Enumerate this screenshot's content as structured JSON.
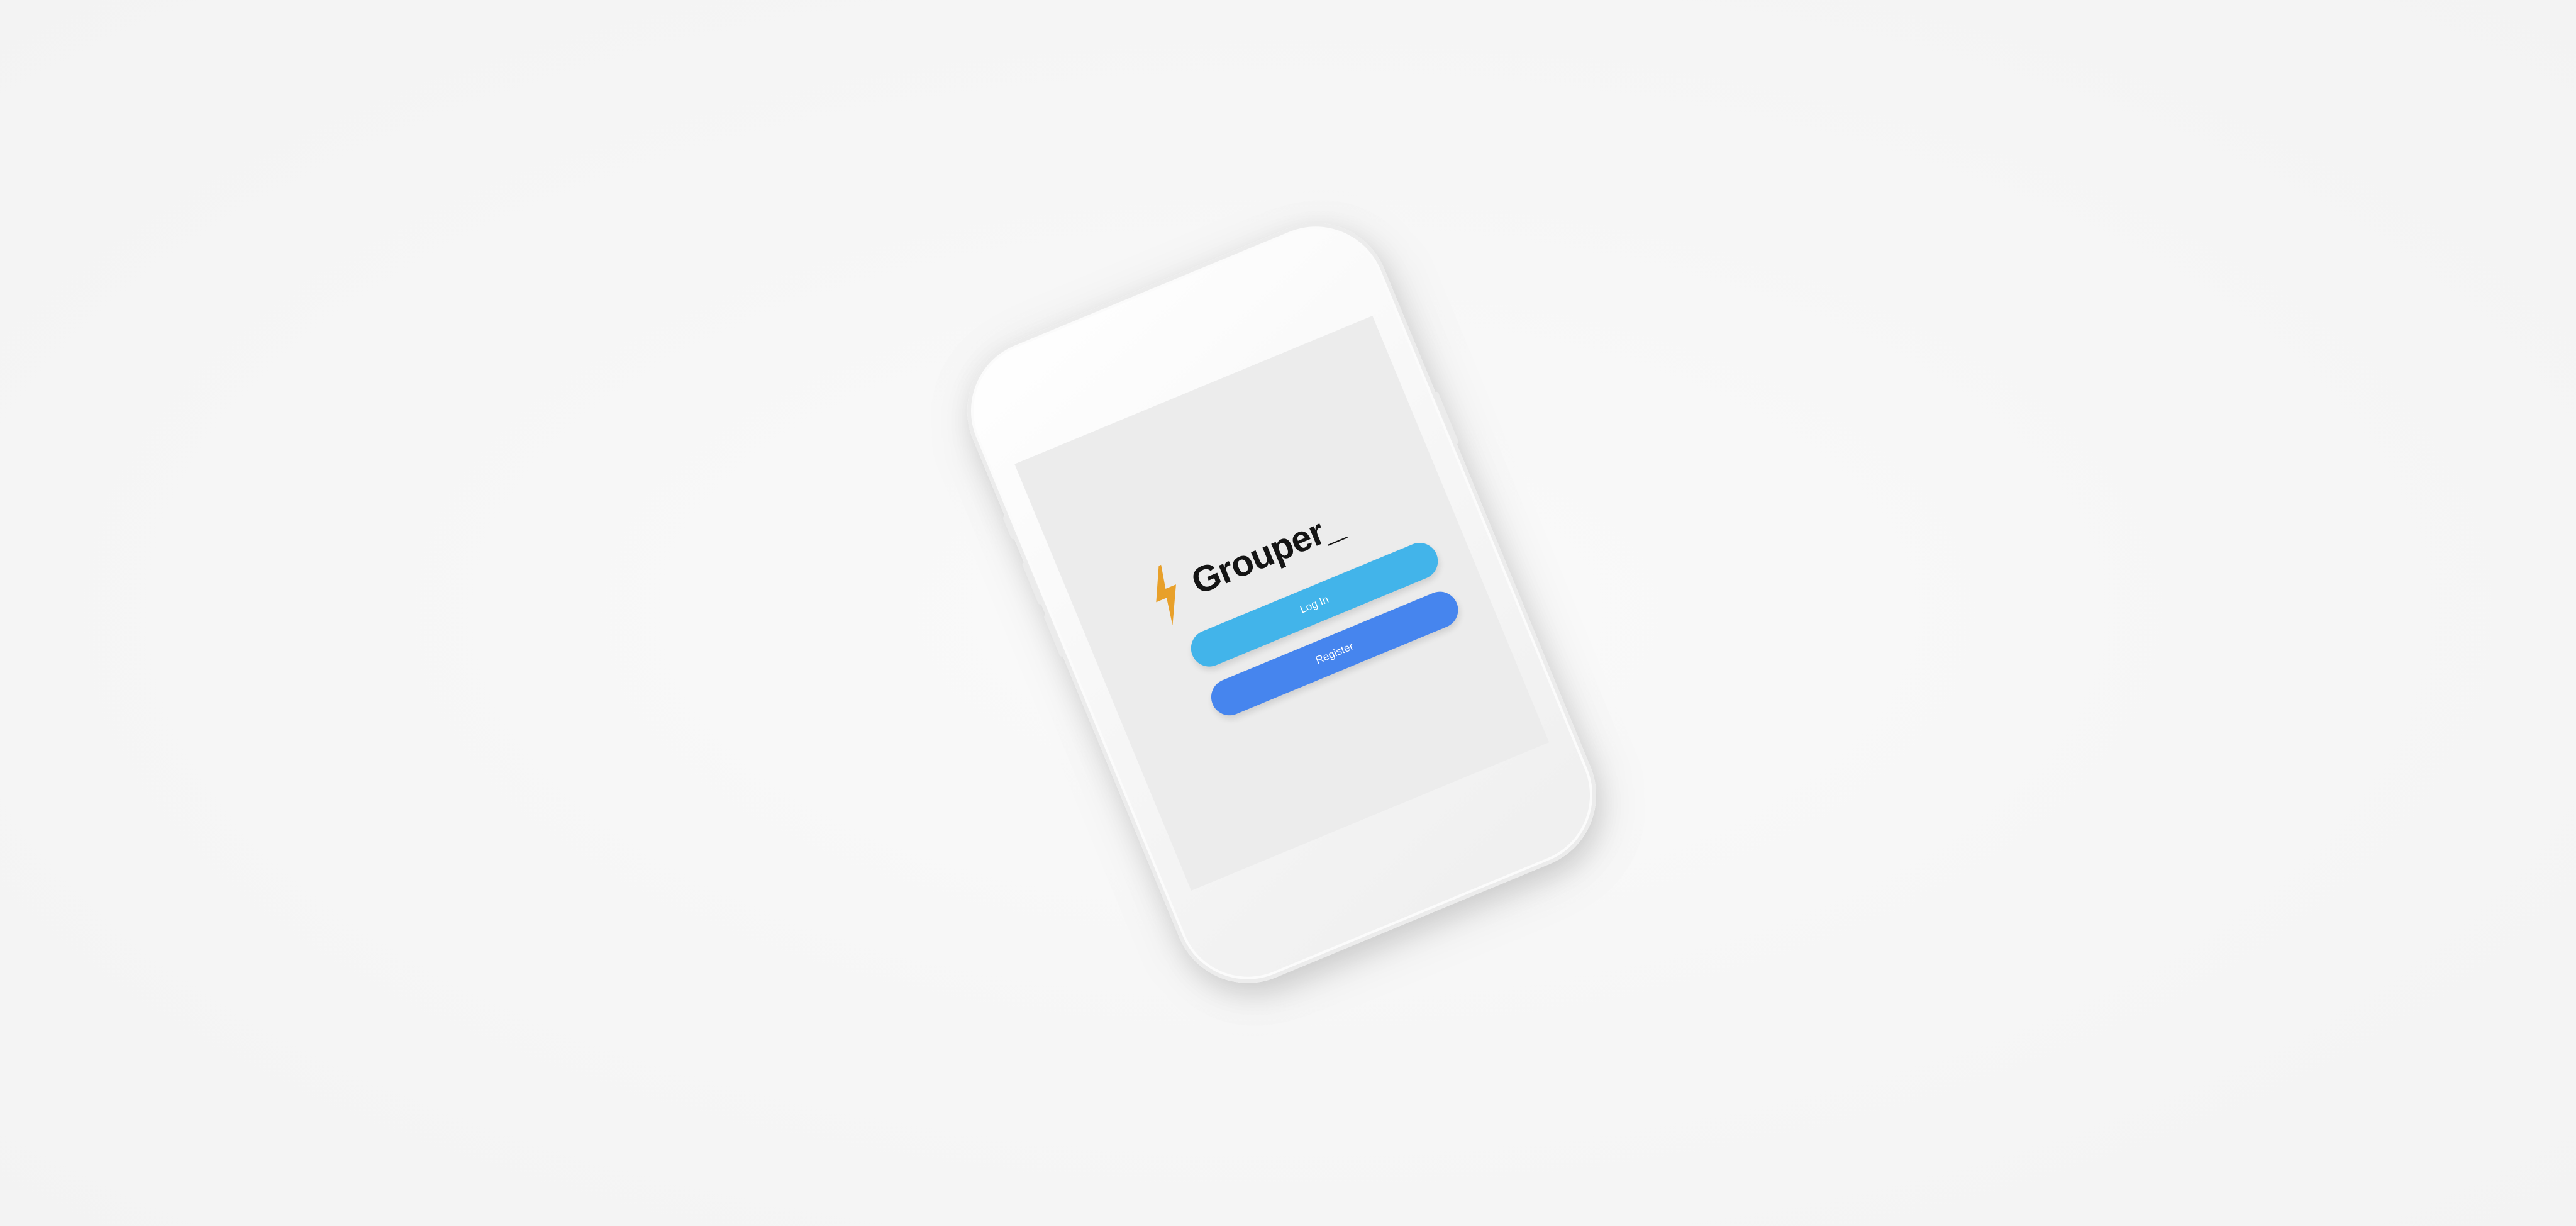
{
  "app": {
    "brand_name": "Grouper_",
    "logo_icon": "lightning-bolt-icon"
  },
  "actions": {
    "login_label": "Log In",
    "register_label": "Register"
  },
  "colors": {
    "background": "#f7f7f7",
    "screen": "#ececec",
    "bolt": "#e8a02a",
    "login_button": "#42b4ea",
    "register_button": "#4685ee",
    "brand_text": "#151515"
  }
}
